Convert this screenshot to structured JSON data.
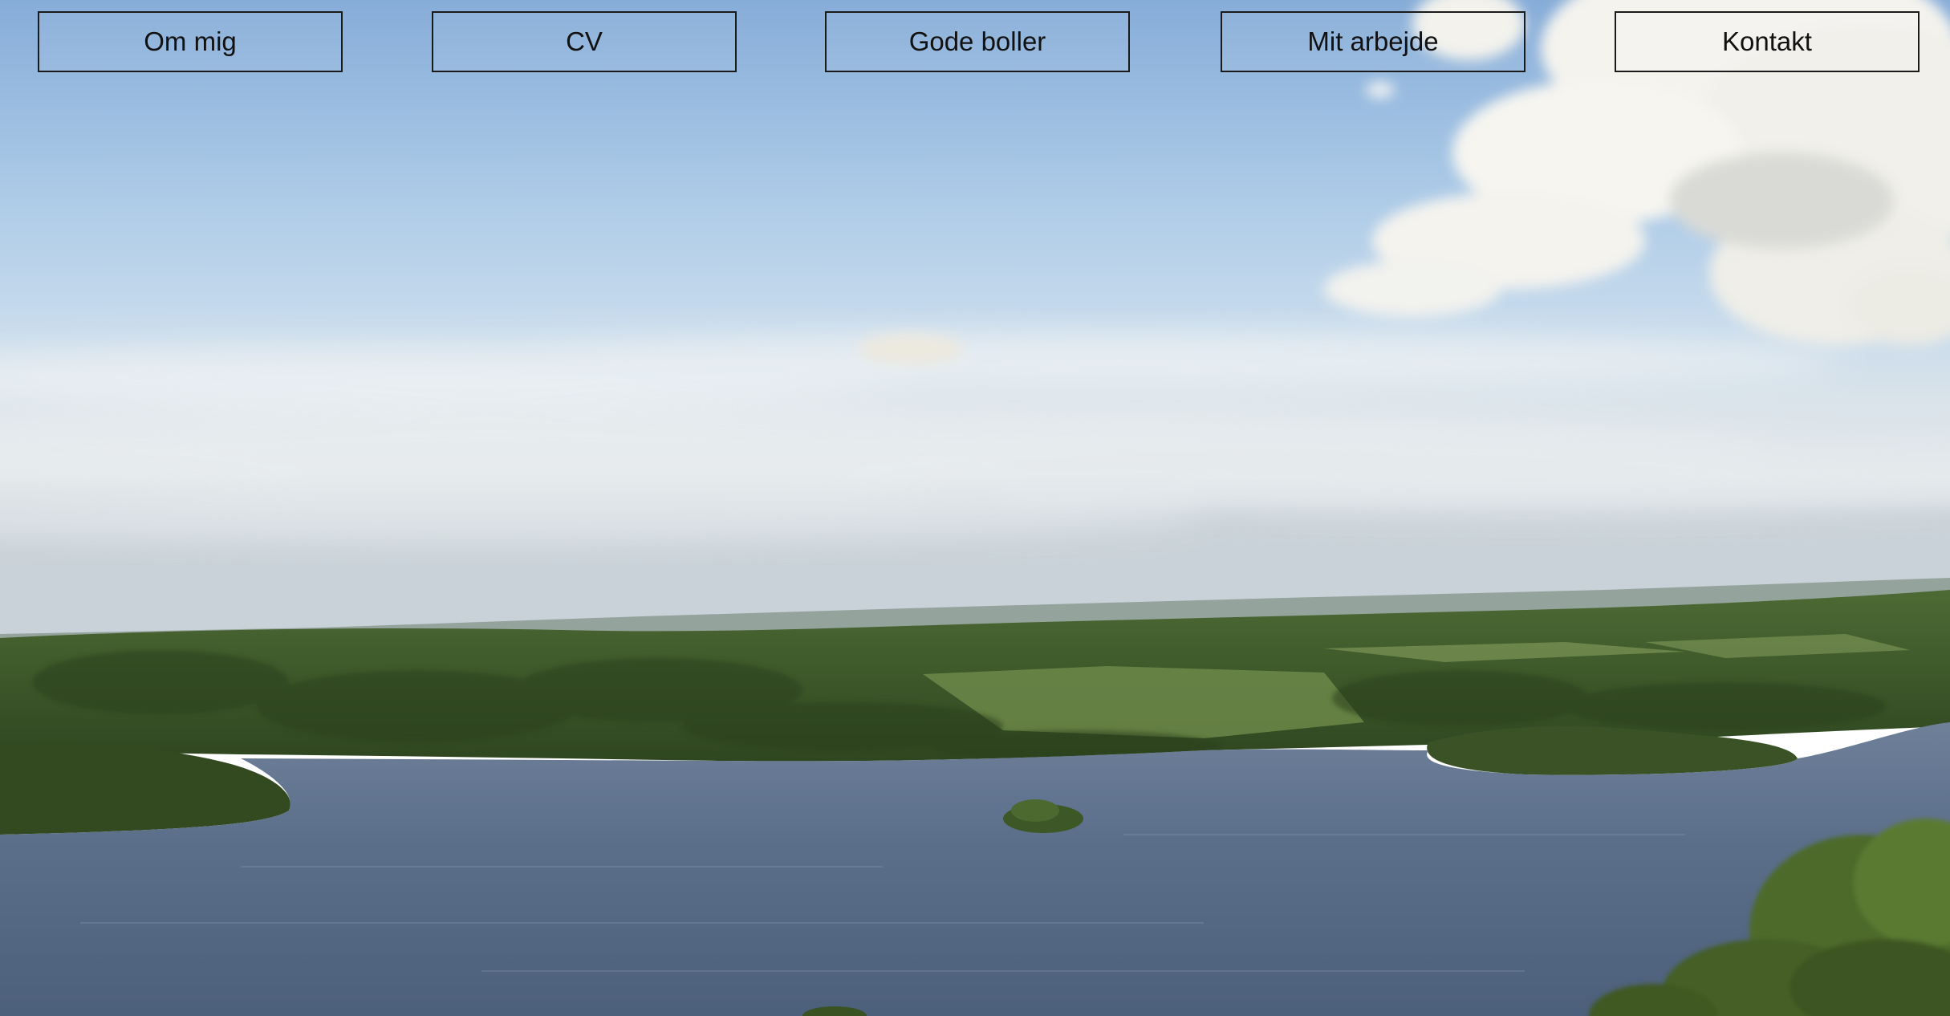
{
  "nav": {
    "items": [
      {
        "label": "Om mig"
      },
      {
        "label": "CV"
      },
      {
        "label": "Gode boller"
      },
      {
        "label": "Mit arbejde"
      },
      {
        "label": "Kontakt"
      }
    ]
  },
  "colors": {
    "sky_top": "#8eb2da",
    "sky_mid": "#bcd5eb",
    "haze": "#dfe6ea",
    "hills": "#3e5a2a",
    "lake": "#5a6f8c",
    "nav_border": "#1a1a1a"
  }
}
